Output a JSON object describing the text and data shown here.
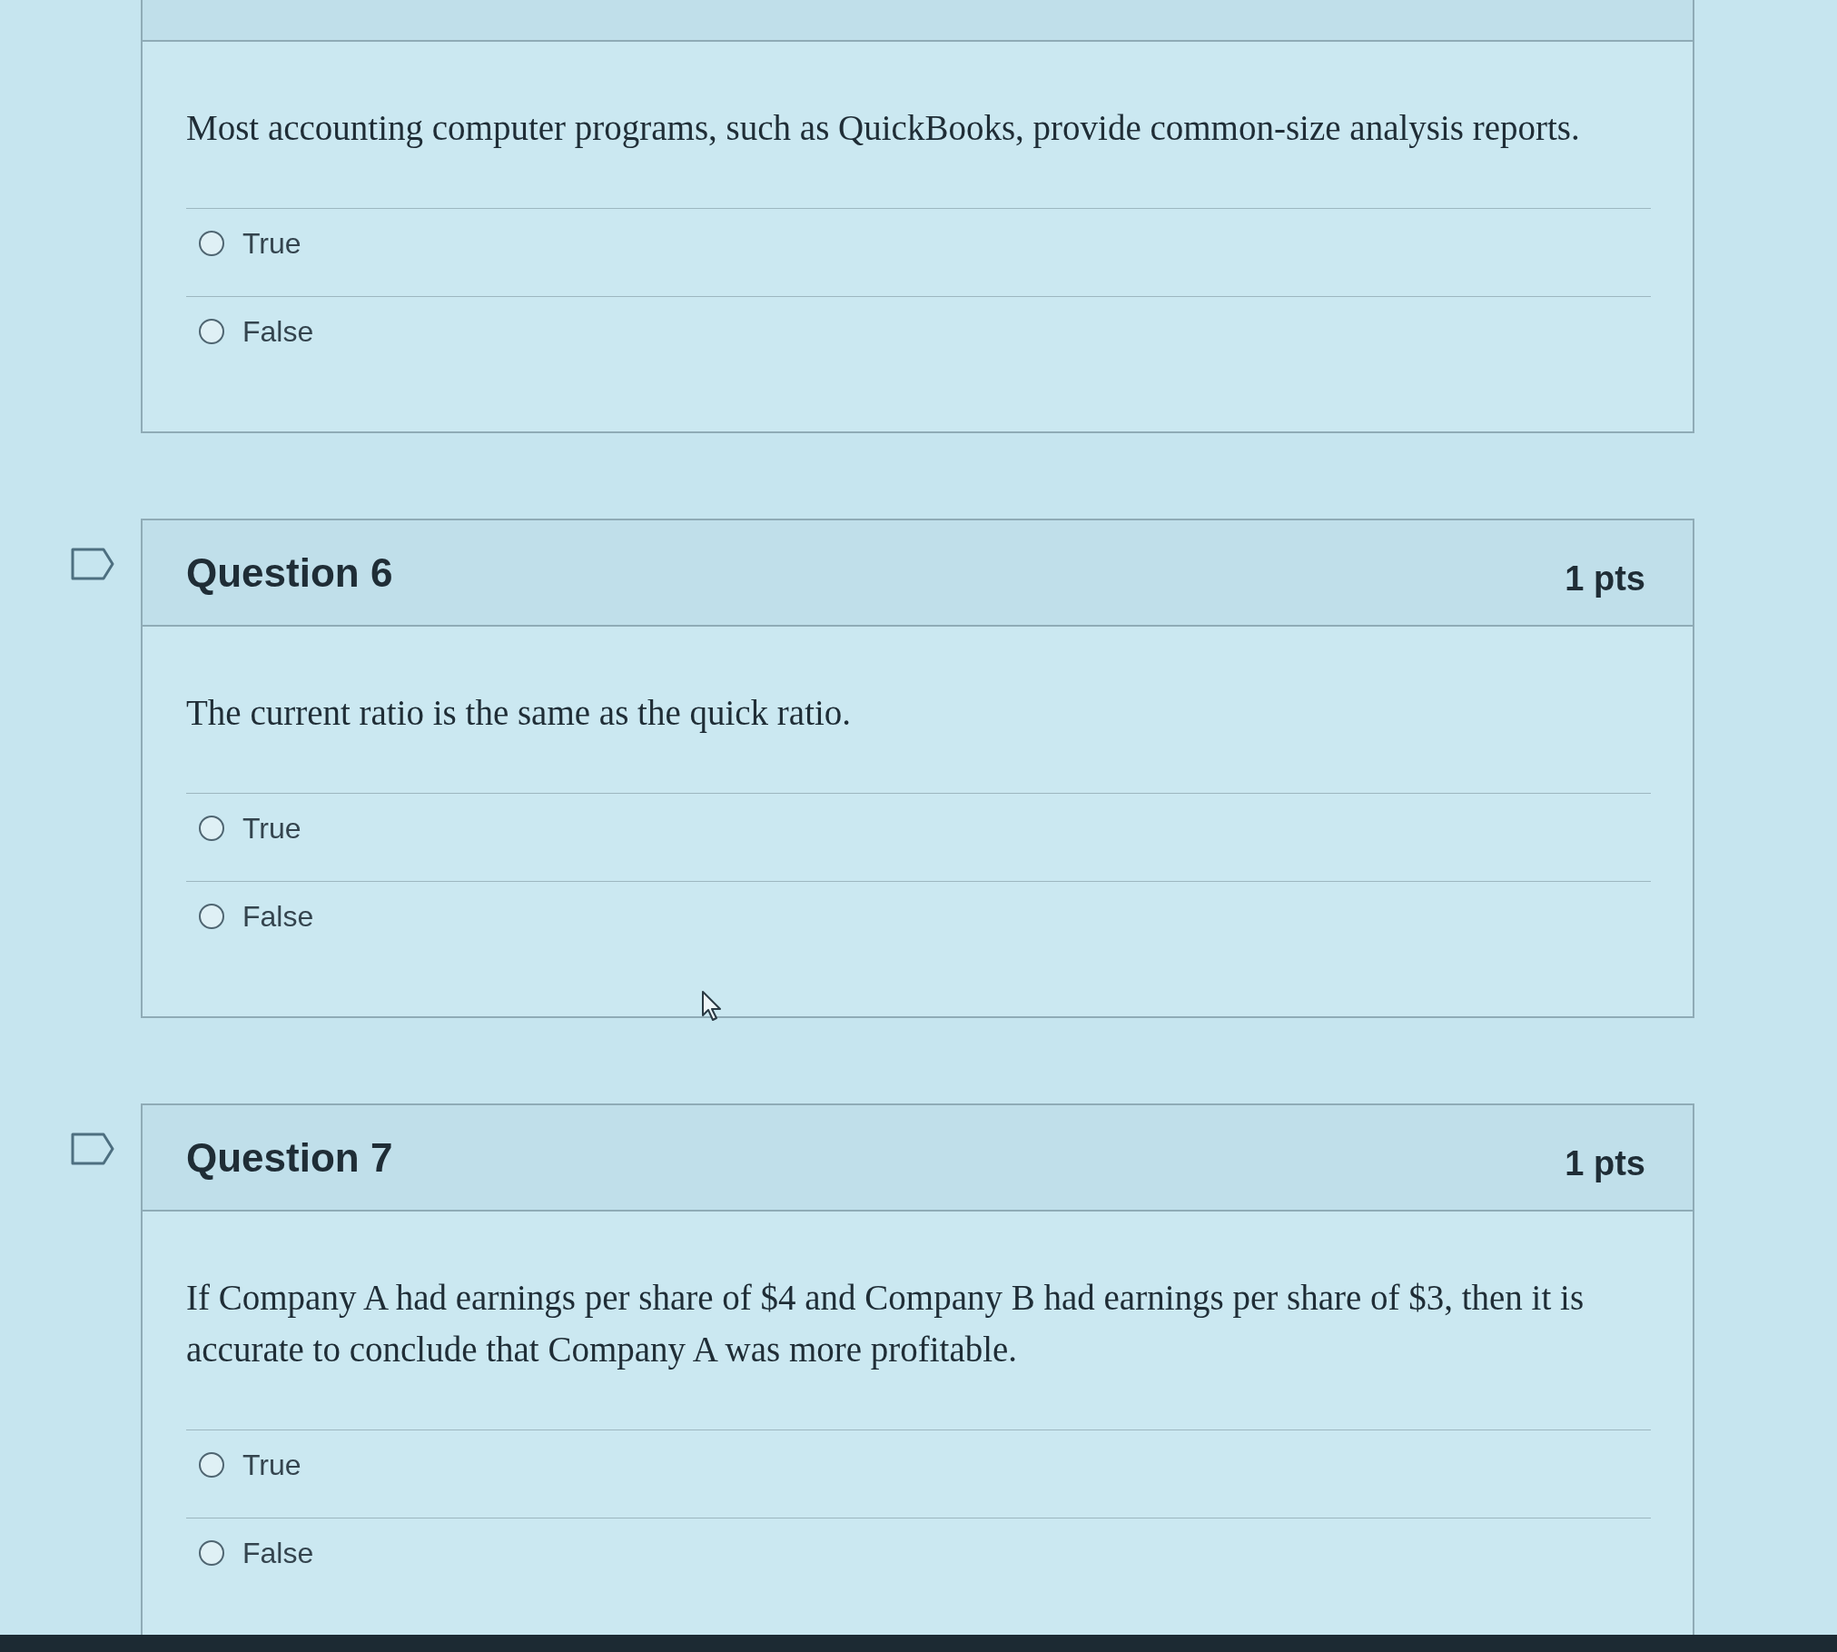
{
  "previous_question": {
    "text": "Most accounting computer programs, such as QuickBooks, provide common-size analysis reports.",
    "answers": [
      {
        "label": "True",
        "selected": false
      },
      {
        "label": "False",
        "selected": false
      }
    ]
  },
  "questions": [
    {
      "title": "Question 6",
      "points": "1 pts",
      "flagged": false,
      "text": "The current ratio is the same as the quick ratio.",
      "answers": [
        {
          "label": "True",
          "selected": false
        },
        {
          "label": "False",
          "selected": false
        }
      ]
    },
    {
      "title": "Question 7",
      "points": "1 pts",
      "flagged": false,
      "text": "If Company A had earnings per share of $4 and Company B had earnings per share of $3, then it is accurate to conclude that Company A was more profitable.",
      "answers": [
        {
          "label": "True",
          "selected": false
        },
        {
          "label": "False",
          "selected": false
        }
      ]
    }
  ]
}
